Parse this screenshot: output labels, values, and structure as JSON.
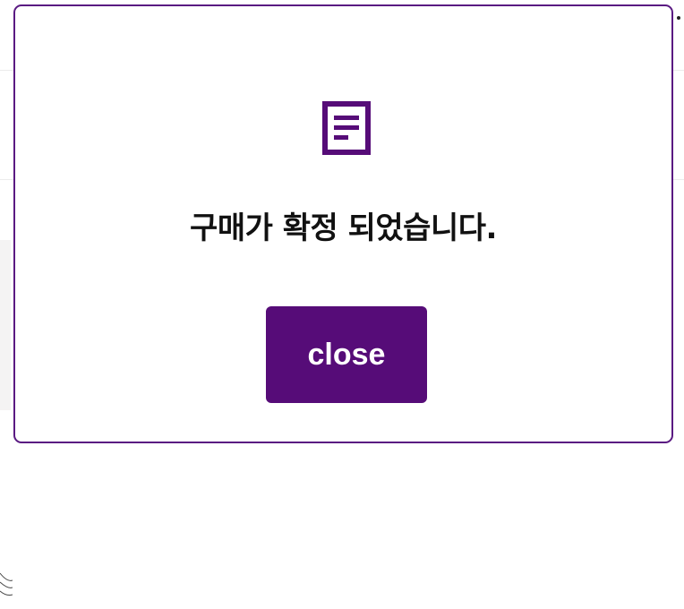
{
  "modal": {
    "icon": "document-icon",
    "message": "구매가 확정 되었습니다.",
    "close_label": "close"
  },
  "colors": {
    "accent": "#560c78",
    "border": "#5a1a82",
    "text": "#111111"
  }
}
